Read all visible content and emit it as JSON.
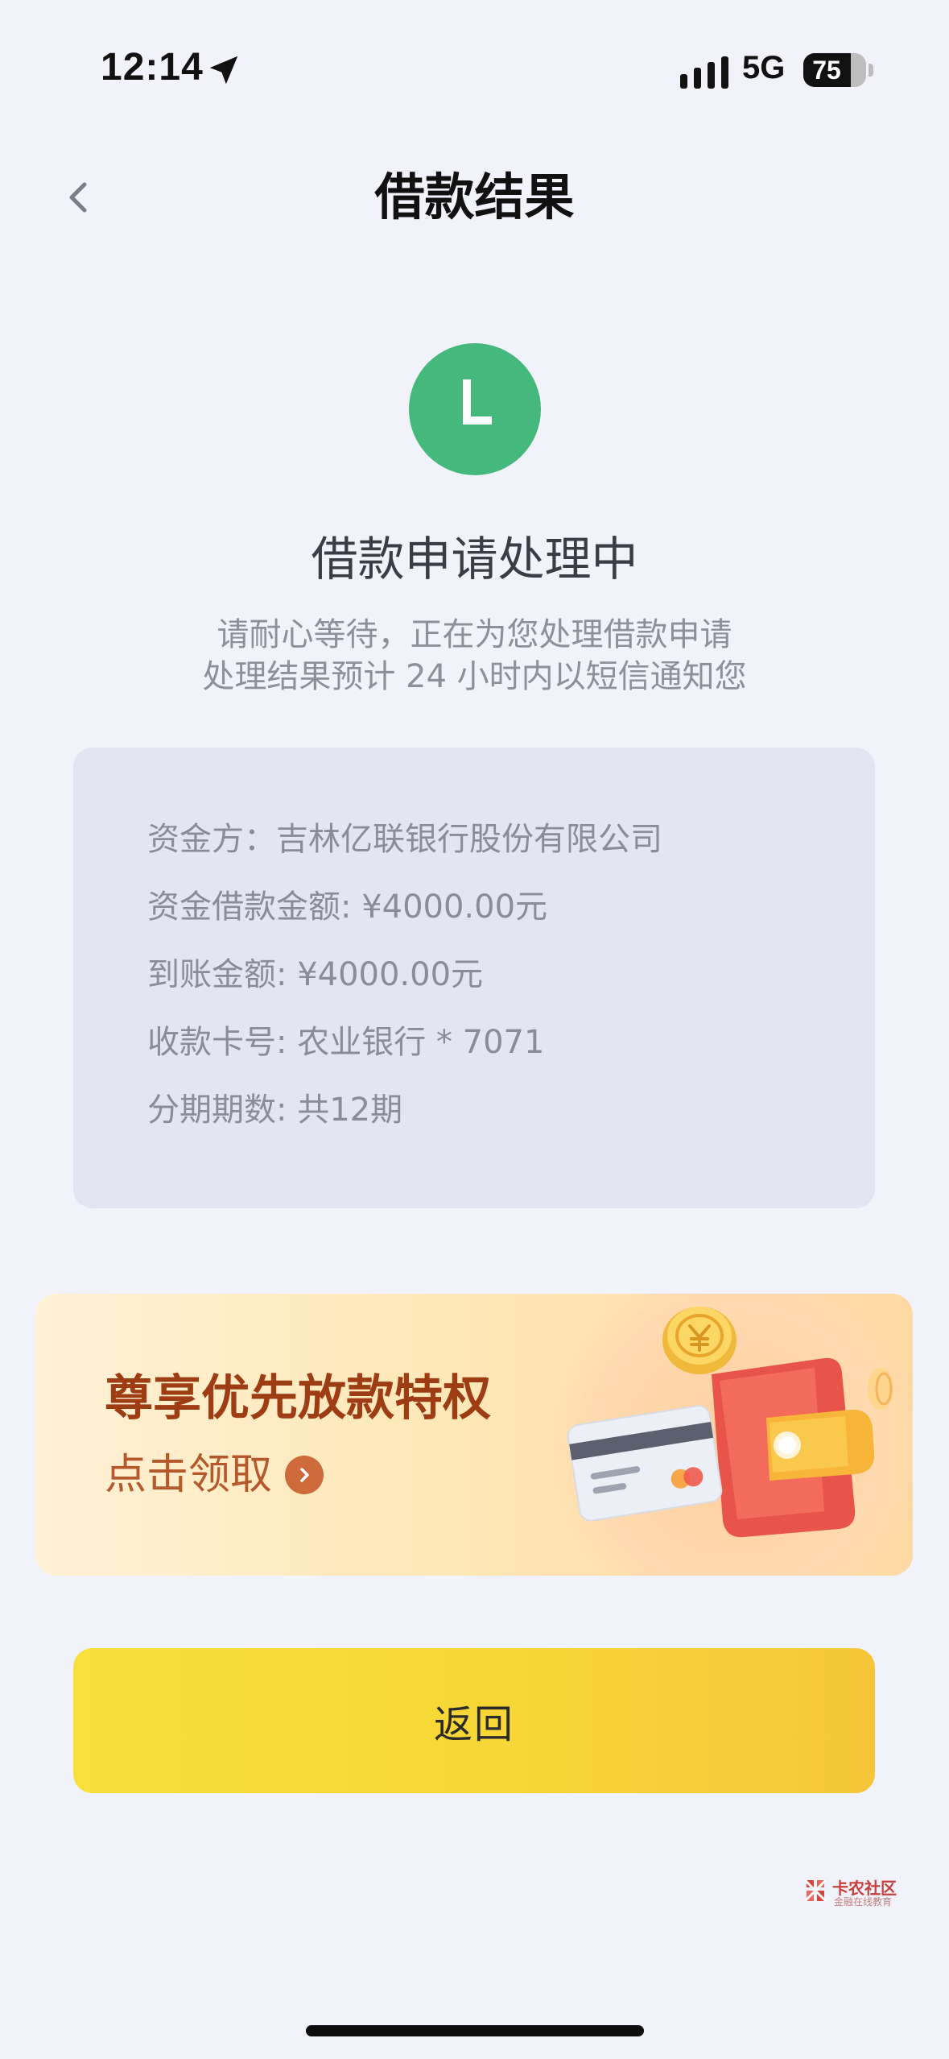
{
  "status_bar": {
    "time": "12:14",
    "network": "5G",
    "battery_level": "75",
    "battery_fraction": 0.75,
    "icons": [
      "location-arrow-icon",
      "cellular-signal-icon",
      "battery-icon"
    ]
  },
  "nav": {
    "back_icon": "chevron-left-icon",
    "title": "借款结果"
  },
  "status": {
    "icon": "clock-icon",
    "icon_color": "#45b97c",
    "title": "借款申请处理中",
    "desc_line1": "请耐心等待，正在为您处理借款申请",
    "desc_line2": "处理结果预计 24 小时内以短信通知您"
  },
  "info": {
    "rows": [
      "资金方：吉林亿联银行股份有限公司",
      "资金借款金额: ¥4000.00元",
      "到账金额: ¥4000.00元",
      "收款卡号: 农业银行 * 7071",
      "分期期数: 共12期"
    ]
  },
  "promo": {
    "title": "尊享优先放款特权",
    "cta_label": "点击领取",
    "cta_icon": "chevron-right-circle-icon",
    "illustration": "wallet-card-coin-illustration",
    "accent_color": "#9e3c14"
  },
  "actions": {
    "return_label": "返回",
    "button_color": "#f7d636"
  },
  "watermark": {
    "name": "卡农社区",
    "sub": "金融在线教育"
  }
}
